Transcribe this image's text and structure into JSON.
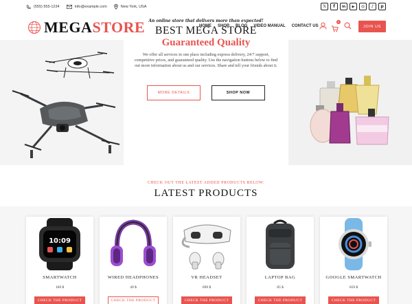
{
  "topbar": {
    "phone": "(555) 555-1234",
    "email": "info@example.com",
    "location": "New York, USA",
    "social": [
      "x-icon",
      "facebook-icon",
      "linkedin-icon",
      "youtube-icon",
      "instagram-icon",
      "tiktok-icon",
      "pinterest-icon"
    ]
  },
  "header": {
    "logo_a": "MEGA",
    "logo_b": "STORE",
    "nav": [
      "HOME",
      "SHOP",
      "BLOG",
      "VIDEO MANUAL",
      "CONTACT US"
    ],
    "cart_count": "0",
    "join_label": "JOIN US"
  },
  "hero": {
    "tagline": "An online store that delivers more than expected!",
    "title": "BEST MEGA STORE",
    "subtitle": "Guaranteed Quality",
    "description": "We offer all services in one place including express delivery, 24/7 support, competitive prices, and guaranteed quality. Use the navigation buttons below to find out more information about us and our services. Share and tell your friends about it.",
    "btn_details": "MORE DETAILS",
    "btn_shop": "SHOP NOW"
  },
  "section": {
    "kicker": "CHECK OUT THE LATEST ADDED PRODUCTS BELOW:",
    "title": "LATEST PRODUCTS"
  },
  "products": [
    {
      "name": "SMARTWATCH",
      "price": "169 $",
      "cta": "CHECK THE PRODUCT"
    },
    {
      "name": "WIRED HEADPHONES",
      "price": "49 $",
      "cta": "CHECK THE PRODUCT"
    },
    {
      "name": "VR HEADSET",
      "price": "699 $",
      "cta": "CHECK THE PRODUCT"
    },
    {
      "name": "LAPTOP BAG",
      "price": "85 $",
      "cta": "CHECK THE PRODUCT"
    },
    {
      "name": "GOOGLE SMARTWATCH",
      "price": "659 $",
      "cta": "CHECK THE PRODUCT"
    }
  ],
  "colors": {
    "accent": "#e8544f",
    "dark": "#111111",
    "hero_bg": "#f4f4f4"
  }
}
